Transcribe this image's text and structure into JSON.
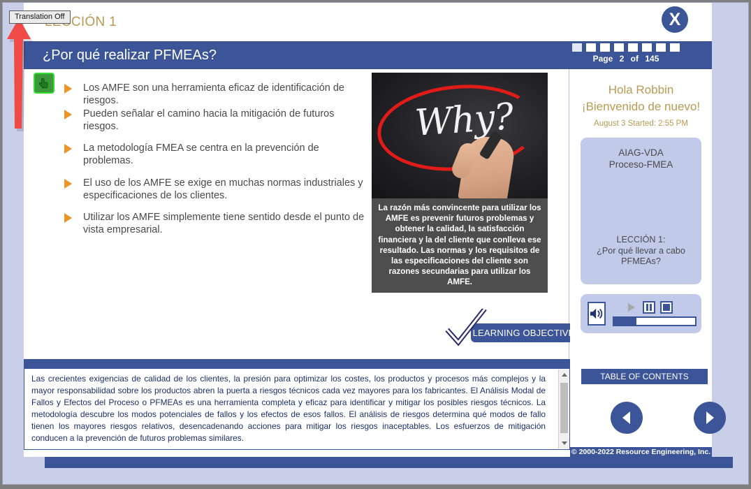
{
  "annotation": {
    "translation_button_label": "Translation Off",
    "arrow_color": "#f04a46"
  },
  "header": {
    "eyebrow": "LECCIÓN 1",
    "title": "¿Por qué realizar PFMEAs?",
    "close_label": "X",
    "accent_color": "#3b5598",
    "gold_color": "#b99a55"
  },
  "pager": {
    "squares": 8,
    "page_label": "Page",
    "current_page": "2",
    "of_label": "of",
    "total_pages": "145"
  },
  "main": {
    "hand_icon_name": "green-pointing-hand-icon",
    "bullets": [
      "Los AMFE son una herramienta eficaz de identificación de riesgos.",
      "Pueden señalar el camino hacia la mitigación de futuros riesgos.",
      "La metodología FMEA se centra en la prevención de problemas.",
      "El uso de los AMFE se exige en muchas normas industriales y especificaciones de los clientes.",
      "Utilizar los AMFE simplemente tiene sentido desde el punto de vista empresarial."
    ],
    "image": {
      "word": "Why?",
      "alt_name": "why-handwritten-photo"
    },
    "caption": "La razón más convincente para utilizar los AMFE es prevenir futuros problemas y obtener la calidad, la satisfacción financiera y la del cliente que conlleva ese resultado.  Las normas y los requisitos de las especificaciones del cliente son razones secundarias para utilizar los AMFE.",
    "learning_objectives_label": "LEARNING OBJECTIVES"
  },
  "sidebar": {
    "greeting_line1": "Hola Robbin",
    "greeting_line2": "¡Bienvenido de nuevo!",
    "started": "August 3 Started: 2:55 PM",
    "course_title": "AIAG-VDA\nProceso-FMEA",
    "course_title_line1": "AIAG-VDA",
    "course_title_line2": "Proceso-FMEA",
    "lesson_line1": "LECCIÓN 1:",
    "lesson_line2": "¿Por qué llevar a cabo",
    "lesson_line3": "PFMEAs?",
    "media": {
      "speaker_icon": "speaker-on-icon",
      "play_icon": "play-icon",
      "pause_icon": "pause-icon",
      "stop_icon": "stop-icon",
      "progress_percent": 28
    },
    "toc_label": "TABLE OF CONTENTS",
    "prev_icon": "previous-arrow-icon",
    "next_icon": "next-arrow-icon",
    "copyright": "© 2000-2022 Resource Engineering, Inc."
  },
  "body_panel": {
    "text": "Las crecientes exigencias de calidad de los clientes, la presión para optimizar los costes, los productos y procesos más complejos y la mayor responsabilidad sobre los productos abren la puerta a riesgos técnicos cada vez mayores para los fabricantes. El Análisis Modal de Fallos y Efectos del Proceso o PFMEAs es una herramienta completa y eficaz para identificar y mitigar los posibles riesgos técnicos. La metodología descubre los modos potenciales de fallos y los efectos de esos fallos. El análisis de riesgos determina qué modos de fallo tienen los mayores riesgos relativos, desencadenando acciones para mitigar los riesgos inaceptables. Los esfuerzos de mitigación conducen a la prevención de futuros problemas similares."
  }
}
